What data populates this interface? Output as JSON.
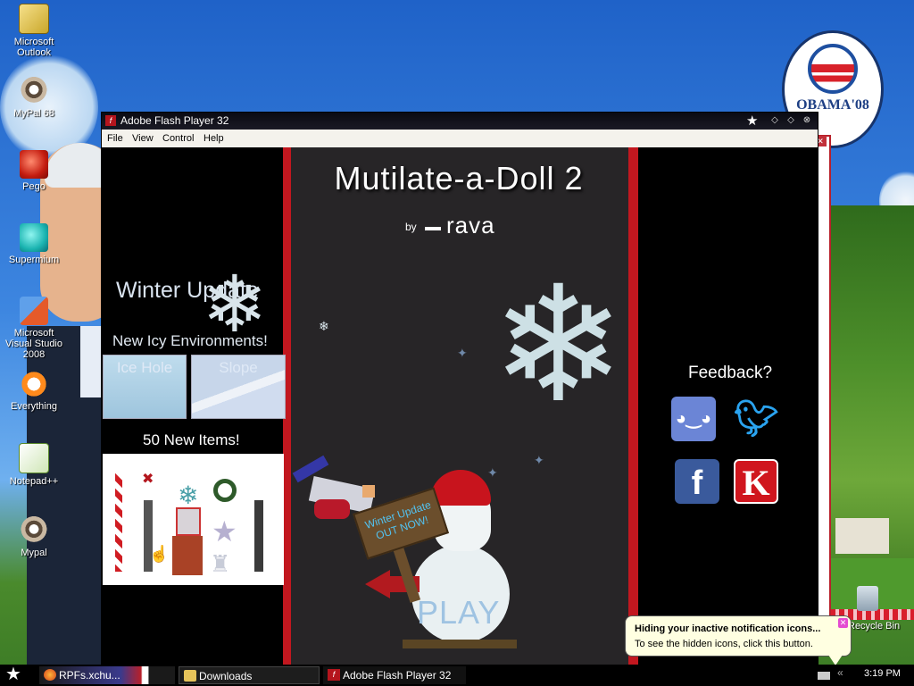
{
  "desktop": {
    "icons": [
      {
        "label": "Microsoft Outlook"
      },
      {
        "label": "MyPal 68"
      },
      {
        "label": "Pego"
      },
      {
        "label": "Supermium"
      },
      {
        "label": "Microsoft Visual Studio 2008"
      },
      {
        "label": "Everything"
      },
      {
        "label": "Notepad++"
      },
      {
        "label": "Mypal"
      }
    ],
    "recycle_bin_label": "Recycle Bin",
    "poster": {
      "text": "OBAMA'08"
    }
  },
  "window": {
    "title": "Adobe Flash Player 32",
    "menu": [
      "File",
      "View",
      "Control",
      "Help"
    ]
  },
  "game": {
    "title": "Mutilate-a-Doll 2",
    "by": "by",
    "author": "rava",
    "left_panel": {
      "heading": "Winter Update",
      "icy_heading": "New Icy Environments!",
      "environments": [
        "Ice Hole",
        "Slope"
      ],
      "items_heading": "50 New Items!"
    },
    "sign_text": "Winter Update OUT NOW!",
    "play_label": "PLAY",
    "feedback": {
      "heading": "Feedback?",
      "links": [
        {
          "name": "Discord",
          "icon": "discord-icon"
        },
        {
          "name": "Twitter",
          "icon": "twitter-icon"
        },
        {
          "name": "Facebook",
          "icon": "facebook-icon"
        },
        {
          "name": "Kongregate",
          "icon": "kongregate-icon"
        }
      ]
    }
  },
  "taskbar": {
    "tasks": [
      {
        "label": "RPFs.xchu...",
        "icon": "firefox-icon"
      },
      {
        "label": "Downloads",
        "icon": "folder-icon"
      },
      {
        "label": "Adobe Flash Player 32",
        "icon": "flash-icon"
      }
    ],
    "clock": "3:19 PM"
  },
  "notification": {
    "title": "Hiding your inactive notification icons...",
    "body": "To see the hidden icons, click this button."
  },
  "colors": {
    "stage_bg": "#272527",
    "accent_red": "#c2171f",
    "balloon_bg": "#ffffe1"
  }
}
